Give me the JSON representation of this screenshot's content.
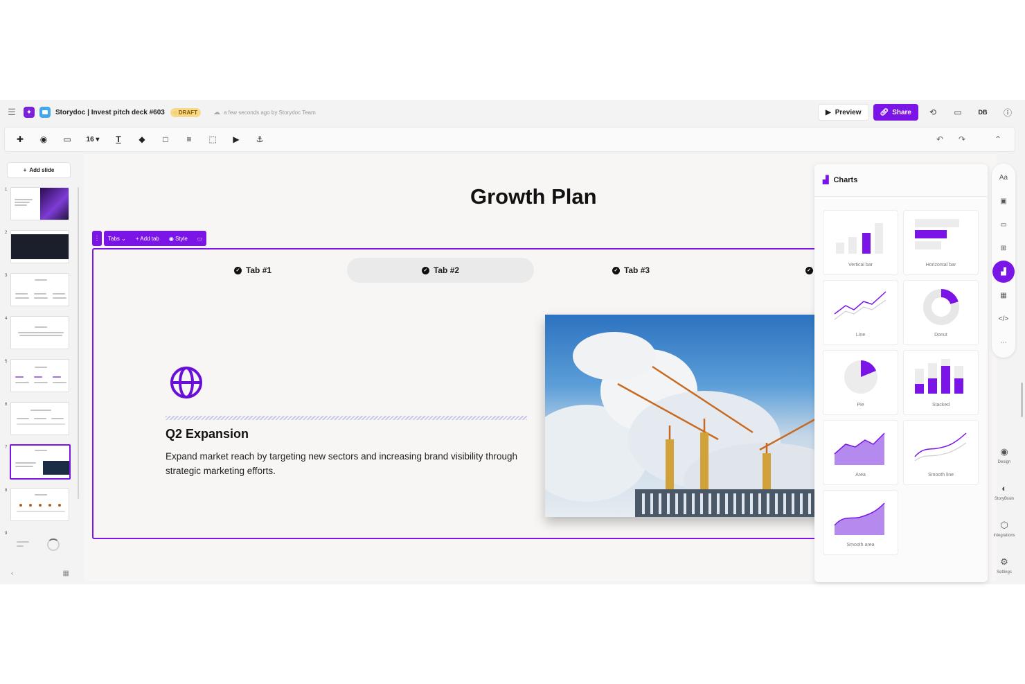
{
  "header": {
    "doc_title": "Storydoc | Invest pitch deck #603",
    "draft_badge": "DRAFT",
    "saved_status": "a few seconds ago by Storydoc Team",
    "preview_label": "Preview",
    "share_label": "Share",
    "user_initials": "DB"
  },
  "toolbar": {
    "font_size": "16"
  },
  "sidebar": {
    "add_slide_label": "Add slide",
    "slides": [
      {
        "num": "1"
      },
      {
        "num": "2"
      },
      {
        "num": "3"
      },
      {
        "num": "4"
      },
      {
        "num": "5"
      },
      {
        "num": "6"
      },
      {
        "num": "7"
      },
      {
        "num": "8"
      },
      {
        "num": "9"
      }
    ],
    "active_slide": "7"
  },
  "slide": {
    "title": "Growth Plan",
    "tabs_tool": {
      "tabs_label": "Tabs",
      "add_tab_label": "Add tab",
      "style_label": "Style"
    },
    "tabs": [
      {
        "label": "Tab #1"
      },
      {
        "label": "Tab #2"
      },
      {
        "label": "Tab #3"
      }
    ],
    "selected_tab": "Tab #2",
    "content": {
      "heading": "Q2 Expansion",
      "body": "Expand market reach by targeting new sectors and increasing brand visibility through strategic marketing efforts."
    }
  },
  "charts_panel": {
    "title": "Charts",
    "items": [
      {
        "label": "Vertical bar"
      },
      {
        "label": "Horizontal bar"
      },
      {
        "label": "Line"
      },
      {
        "label": "Donut"
      },
      {
        "label": "Pie"
      },
      {
        "label": "Stacked"
      },
      {
        "label": "Area"
      },
      {
        "label": "Smooth line"
      },
      {
        "label": "Smooth area"
      }
    ]
  },
  "right_rail": {
    "bottom": [
      {
        "label": "Design"
      },
      {
        "label": "StoryBrain"
      },
      {
        "label": "Integrations"
      },
      {
        "label": "Settings"
      }
    ]
  },
  "colors": {
    "accent": "#7b14e6",
    "draft_bg": "#f7d989"
  }
}
